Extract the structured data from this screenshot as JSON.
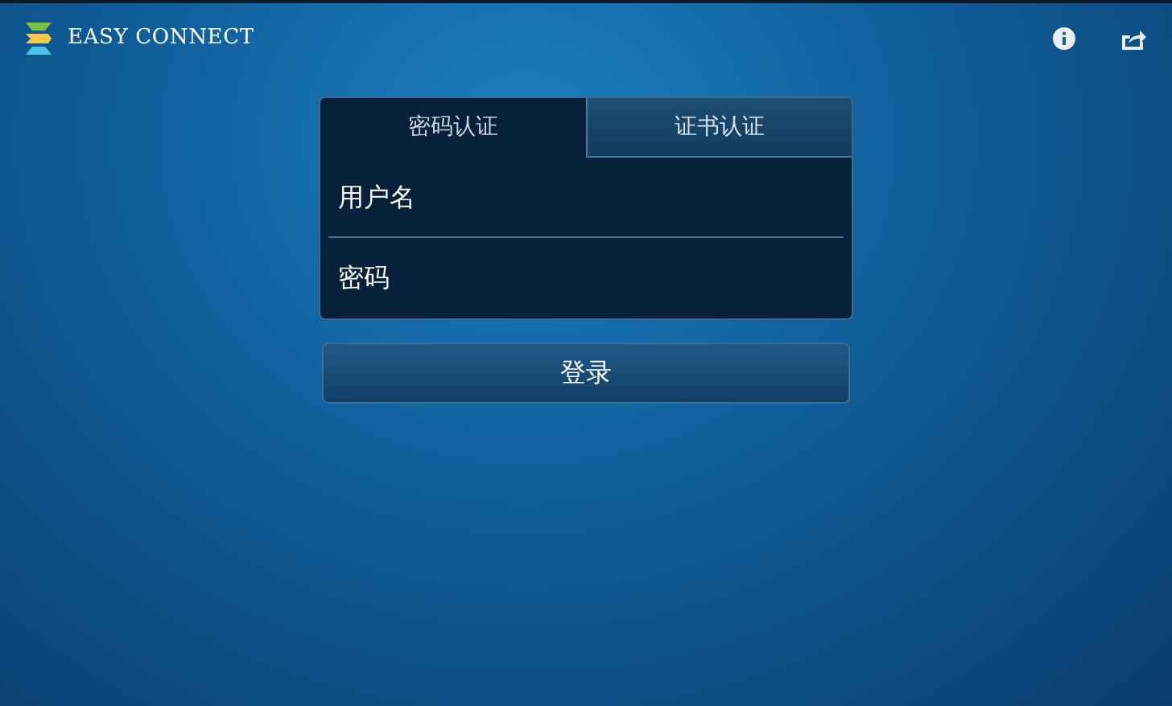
{
  "app": {
    "logo_text": "EASY CONNECT"
  },
  "tabs": [
    {
      "label": "密码认证",
      "selected": true
    },
    {
      "label": "证书认证",
      "selected": false
    }
  ],
  "username_field": {
    "placeholder": "用户名"
  },
  "password_field": {
    "placeholder": "密码"
  },
  "login_button": {
    "label": "登录"
  }
}
